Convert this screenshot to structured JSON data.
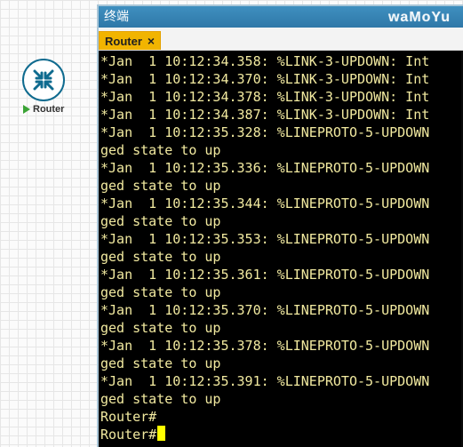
{
  "canvas": {
    "router_label": "Router"
  },
  "window": {
    "title": "终端",
    "watermark": "waMoYu",
    "tab": {
      "label": "Router",
      "close_icon": "×"
    }
  },
  "terminal": {
    "lines": [
      "*Jan  1 10:12:34.358: %LINK-3-UPDOWN: Int",
      "*Jan  1 10:12:34.370: %LINK-3-UPDOWN: Int",
      "*Jan  1 10:12:34.378: %LINK-3-UPDOWN: Int",
      "*Jan  1 10:12:34.387: %LINK-3-UPDOWN: Int",
      "*Jan  1 10:12:35.328: %LINEPROTO-5-UPDOWN",
      "ged state to up",
      "*Jan  1 10:12:35.336: %LINEPROTO-5-UPDOWN",
      "ged state to up",
      "*Jan  1 10:12:35.344: %LINEPROTO-5-UPDOWN",
      "ged state to up",
      "*Jan  1 10:12:35.353: %LINEPROTO-5-UPDOWN",
      "ged state to up",
      "*Jan  1 10:12:35.361: %LINEPROTO-5-UPDOWN",
      "ged state to up",
      "*Jan  1 10:12:35.370: %LINEPROTO-5-UPDOWN",
      "ged state to up",
      "*Jan  1 10:12:35.378: %LINEPROTO-5-UPDOWN",
      "ged state to up",
      "*Jan  1 10:12:35.391: %LINEPROTO-5-UPDOWN",
      "ged state to up",
      "Router#"
    ],
    "prompt": "Router#"
  },
  "colors": {
    "terminal_background": "#000000",
    "terminal_text": "#f2eaa0",
    "titlebar": "#3f8fc0",
    "tab": "#f1b400",
    "cursor": "#ffff00",
    "router_icon": "#0f6b8f",
    "status_running": "#3aa335"
  },
  "icons": {
    "router": "router-icon",
    "status": "play-icon",
    "close": "close-icon"
  }
}
